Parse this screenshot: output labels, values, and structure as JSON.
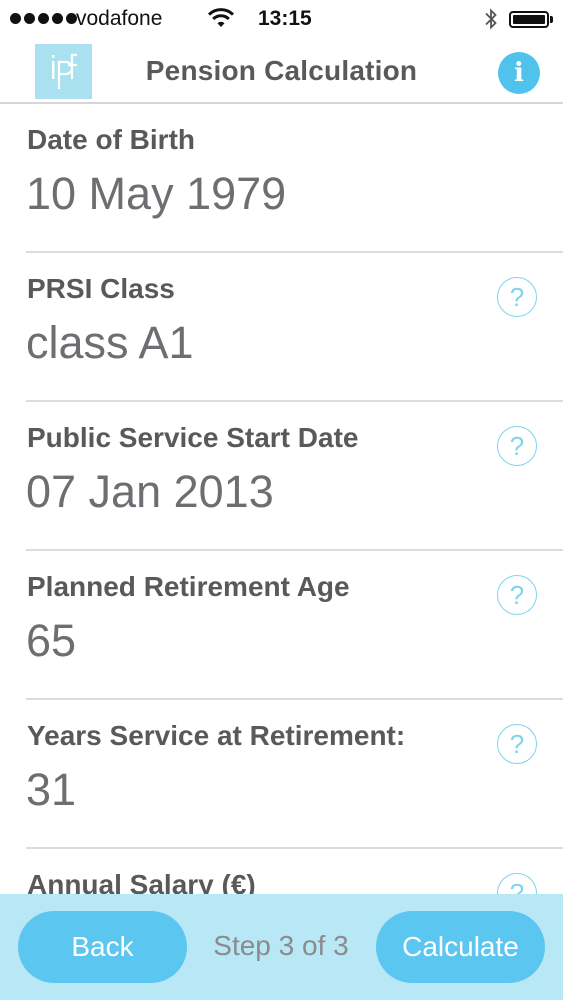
{
  "status_bar": {
    "carrier": "vodafone",
    "time": "13:15",
    "icons": [
      "signal-dots-icon",
      "wifi-icon",
      "bluetooth-icon",
      "battery-icon"
    ]
  },
  "nav": {
    "logo_text": "ipf",
    "title": "Pension Calculation",
    "info_label": "i"
  },
  "fields": [
    {
      "label": "Date of Birth",
      "value": "10 May 1979",
      "has_help": false
    },
    {
      "label": "PRSI Class",
      "value": "class A1",
      "has_help": true
    },
    {
      "label": "Public Service Start Date",
      "value": "07 Jan 2013",
      "has_help": true
    },
    {
      "label": "Planned Retirement Age",
      "value": "65",
      "has_help": true
    },
    {
      "label": "Years Service at Retirement:",
      "value": "31",
      "has_help": true
    },
    {
      "label": "Annual Salary (€)",
      "value": "",
      "has_help": true
    }
  ],
  "help_glyph": "?",
  "footer": {
    "back_label": "Back",
    "step_text": "Step 3 of 3",
    "calculate_label": "Calculate"
  },
  "colors": {
    "accent": "#4fc3ec",
    "button": "#5bc6ef",
    "footer_bg": "#b3e5f5",
    "logo_bg": "#a9e1f0",
    "label_text": "#58595b",
    "value_text": "#6d6e71"
  }
}
